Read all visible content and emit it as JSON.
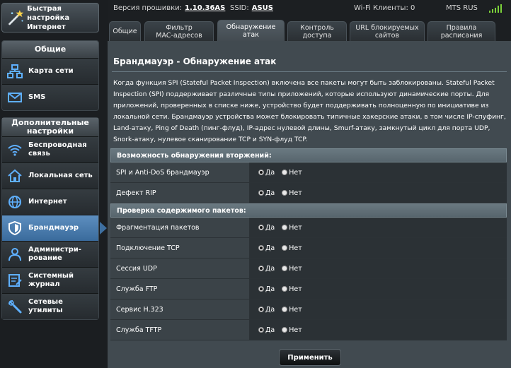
{
  "sidebar": {
    "quick": {
      "label": "Быстрая настройка\nИнтернет",
      "icon": "wand-icon"
    },
    "general": {
      "title": "Общие",
      "items": [
        {
          "label": "Карта сети",
          "icon": "network-map-icon"
        },
        {
          "label": "SMS",
          "icon": "envelope-icon"
        }
      ]
    },
    "advanced": {
      "title": "Дополнительные\nнастройки",
      "items": [
        {
          "label": "Беспроводная\nсвязь",
          "icon": "wifi-icon"
        },
        {
          "label": "Локальная сеть",
          "icon": "home-icon"
        },
        {
          "label": "Интернет",
          "icon": "globe-icon"
        },
        {
          "label": "Брандмауэр",
          "icon": "shield-icon",
          "active": true
        },
        {
          "label": "Администри-\nрование",
          "icon": "admin-icon"
        },
        {
          "label": "Системный\nжурнал",
          "icon": "log-icon"
        },
        {
          "label": "Сетевые утилиты",
          "icon": "tools-icon"
        }
      ]
    }
  },
  "topbar": {
    "firmware_label": "Версия прошивки:",
    "firmware_value": "1.10.36AS",
    "ssid_label": "SSID:",
    "ssid_value": "ASUS",
    "wifi_clients": "Wi-Fi Клиенты: 0",
    "operator": "MTS RUS"
  },
  "tabs": [
    {
      "label": "Общие"
    },
    {
      "label": "Фильтр\nMAC-адресов"
    },
    {
      "label": "Обнаружение\nатак",
      "active": true
    },
    {
      "label": "Контроль\nдоступа"
    },
    {
      "label": "URL блокируемых\nсайтов"
    },
    {
      "label": "Правила\nрасписания"
    }
  ],
  "main": {
    "title": "Брандмауэр - Обнаружение атак",
    "description": "Когда функция SPI (Stateful Packet Inspection) включена все пакеты могут быть заблокированы. Stateful Packet Inspection (SPI) поддерживает различные типы приложений, которые используют динамические порты.  Для приложений, проверенных в списке ниже, устройство будет поддерживать полноценную по инициативе из локальной сети. Брандмауэр устройства может блокировать типичные хакерские атаки, в том числе IP-спуфинг, Land-атаку, Ping of Death (пинг-флуд), IP-адрес нулевой длины, Smurf-атаку, замкнутый цикл для порта UDP, Snork-атаку, нулевое сканирование TCP и SYN-флуд TCP.",
    "yes_label": "Да",
    "no_label": "Нет",
    "sections": [
      {
        "title": "Возможность обнаружения вторжений:",
        "rows": [
          {
            "label": "SPI и Anti-DoS брандмауэр",
            "value": "yes"
          },
          {
            "label": "Дефект RIP",
            "value": "yes"
          }
        ]
      },
      {
        "title": "Проверка содержимого пакетов:",
        "rows": [
          {
            "label": "Фрагментация пакетов",
            "value": "yes"
          },
          {
            "label": "Подключение TCP",
            "value": "yes"
          },
          {
            "label": "Сессия UDP",
            "value": "yes"
          },
          {
            "label": "Служба FTP",
            "value": "yes"
          },
          {
            "label": "Сервис H.323",
            "value": "yes"
          },
          {
            "label": "Служба TFTP",
            "value": "yes"
          }
        ]
      }
    ],
    "apply_label": "Применить"
  },
  "colors": {
    "accent": "#3e6fa0",
    "panel": "#414a50",
    "section_header": "#5f6e76",
    "signal": "#7cd23a"
  }
}
